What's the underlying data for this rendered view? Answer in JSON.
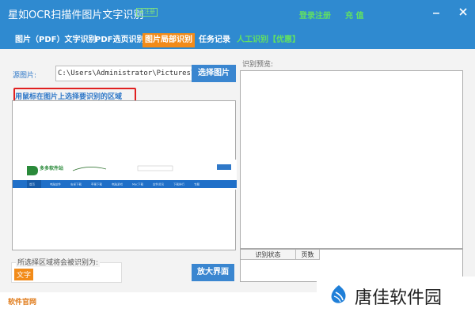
{
  "window": {
    "title": "星如OCR扫描件图片文字识别",
    "unregistered_badge": "未注册",
    "register_link": "登录注册",
    "recharge_link": "充 值",
    "minimize_icon": "minimize-icon",
    "close_icon": "close-icon"
  },
  "tabs": [
    {
      "label": "图片（PDF）文字识别",
      "active": false
    },
    {
      "label": "PDF选页识别",
      "active": false
    },
    {
      "label": "图片局部识别",
      "active": true
    },
    {
      "label": "任务记录",
      "active": false
    },
    {
      "label": "人工识别【优惠】",
      "active": false
    }
  ],
  "source": {
    "label": "源图片:",
    "path_value": "C:\\Users\\Administrator\\Pictures\\微",
    "select_button": "选择图片"
  },
  "hint": "用鼠标在图片上选择要识别的区域",
  "preview": {
    "thumbnail": {
      "site_name": "多多软件站",
      "nav": [
        "首页",
        "电脑软件",
        "安卓下载",
        "苹果下载",
        "电脑游戏",
        "Mac下载",
        "软件资讯",
        "下载排行",
        "专题"
      ]
    }
  },
  "result": {
    "label": "所选择区域将会被识别为:",
    "type_badge": "文字"
  },
  "enlarge_button": "放大界面",
  "recognition": {
    "preview_label": "识别预览:",
    "status_columns": [
      "识别状态",
      "页数"
    ]
  },
  "footer": {
    "official_site": "软件官网"
  },
  "watermark": {
    "text": "唐佳软件园"
  },
  "colors": {
    "titlebar": "#2f8ad0",
    "active_tab": "#f28b19",
    "link_green": "#62e062",
    "highlight_red": "#e02020"
  }
}
